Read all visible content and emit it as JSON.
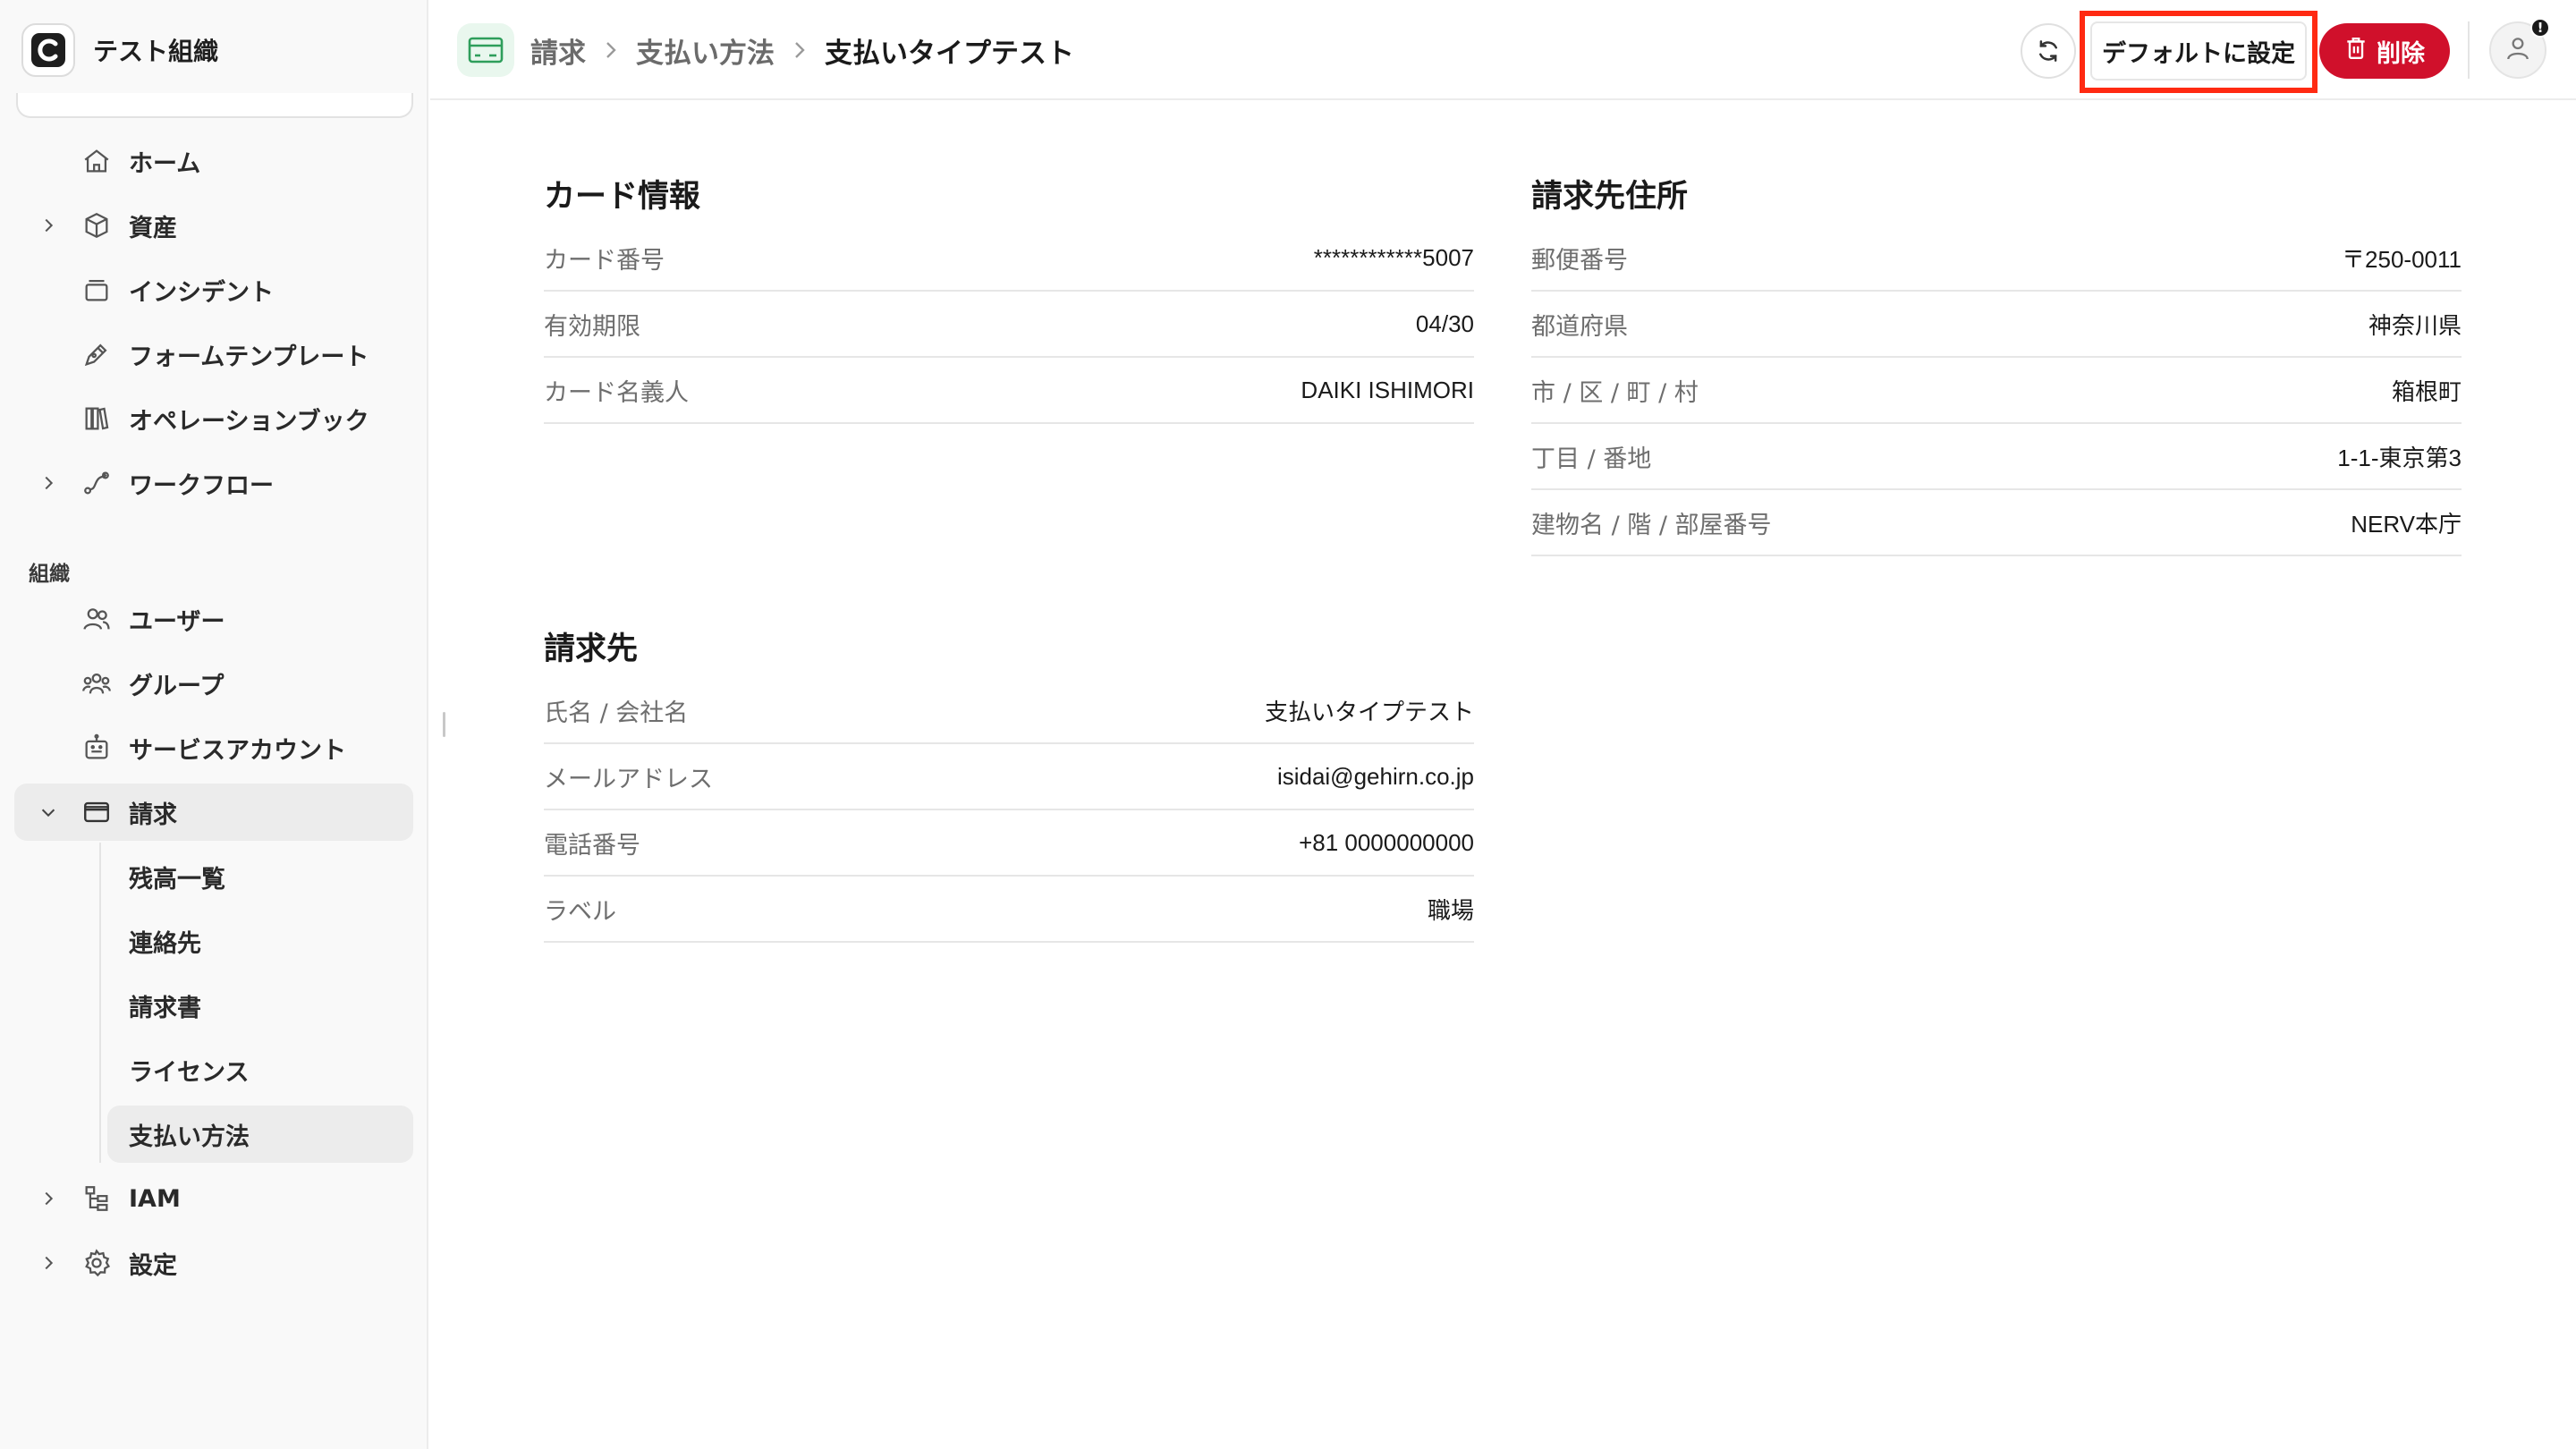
{
  "org": {
    "name": "テスト組織"
  },
  "sidebar": {
    "items": [
      {
        "label": "ホーム"
      },
      {
        "label": "資産"
      },
      {
        "label": "インシデント"
      },
      {
        "label": "フォームテンプレート"
      },
      {
        "label": "オペレーションブック"
      },
      {
        "label": "ワークフロー"
      }
    ],
    "section_label": "組織",
    "org_items": [
      {
        "label": "ユーザー"
      },
      {
        "label": "グループ"
      },
      {
        "label": "サービスアカウント"
      },
      {
        "label": "請求"
      }
    ],
    "billing_sub": [
      {
        "label": "残高一覧"
      },
      {
        "label": "連絡先"
      },
      {
        "label": "請求書"
      },
      {
        "label": "ライセンス"
      },
      {
        "label": "支払い方法"
      }
    ],
    "bottom_items": [
      {
        "label": "IAM"
      },
      {
        "label": "設定"
      }
    ]
  },
  "header": {
    "breadcrumb": [
      "請求",
      "支払い方法",
      "支払いタイプテスト"
    ],
    "default_label": "デフォルトに設定",
    "delete_label": "削除",
    "badge": "!"
  },
  "card": {
    "title": "カード情報",
    "rows": [
      {
        "key": "カード番号",
        "value": "************5007"
      },
      {
        "key": "有効期限",
        "value": "04/30"
      },
      {
        "key": "カード名義人",
        "value": "DAIKI ISHIMORI"
      }
    ]
  },
  "address": {
    "title": "請求先住所",
    "rows": [
      {
        "key": "郵便番号",
        "value": "〒250-0011"
      },
      {
        "key": "都道府県",
        "value": "神奈川県"
      },
      {
        "key": "市 / 区 / 町 / 村",
        "value": "箱根町"
      },
      {
        "key": "丁目 / 番地",
        "value": "1-1-東京第3"
      },
      {
        "key": "建物名 / 階 / 部屋番号",
        "value": "NERV本庁"
      }
    ]
  },
  "billing_to": {
    "title": "請求先",
    "rows": [
      {
        "key": "氏名 / 会社名",
        "value": "支払いタイプテスト"
      },
      {
        "key": "メールアドレス",
        "value": "isidai@gehirn.co.jp"
      },
      {
        "key": "電話番号",
        "value": "+81 0000000000"
      },
      {
        "key": "ラベル",
        "value": "職場"
      }
    ]
  },
  "colors": {
    "accent_red": "#d0102b",
    "highlight_frame": "#ff2a12",
    "card_icon_green": "#2e9e5b"
  }
}
